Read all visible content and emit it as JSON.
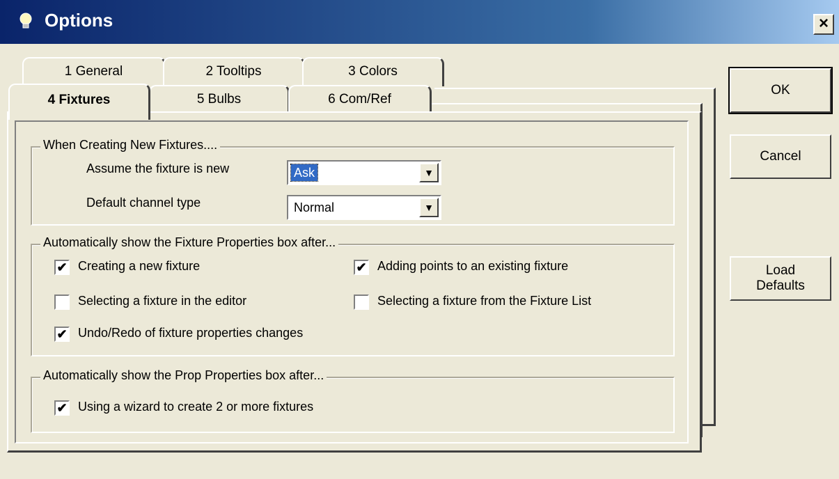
{
  "window": {
    "title": "Options",
    "close_label": "×"
  },
  "tabs": {
    "general": "1 General",
    "tooltips": "2 Tooltips",
    "colors": "3 Colors",
    "fixtures": "4 Fixtures",
    "bulbs": "5 Bulbs",
    "comref": "6 Com/Ref"
  },
  "groups": {
    "new_fixtures": {
      "legend": "When Creating New Fixtures....",
      "assume_label": "Assume the fixture is new",
      "assume_value": "Ask",
      "channel_label": "Default channel type",
      "channel_value": "Normal"
    },
    "fixture_props": {
      "legend": "Automatically show the Fixture Properties box after...",
      "items": [
        {
          "label": "Creating a new fixture",
          "checked": true
        },
        {
          "label": "Adding points to an existing fixture",
          "checked": true
        },
        {
          "label": "Selecting a fixture in the editor",
          "checked": false
        },
        {
          "label": "Selecting a fixture from the Fixture List",
          "checked": false
        },
        {
          "label": "Undo/Redo of fixture properties changes",
          "checked": true
        }
      ]
    },
    "prop_props": {
      "legend": "Automatically show the Prop Properties box after...",
      "items": [
        {
          "label": "Using a wizard to create 2 or more fixtures",
          "checked": true
        }
      ]
    }
  },
  "buttons": {
    "ok": "OK",
    "cancel": "Cancel",
    "load": "Load",
    "defaults": "Defaults"
  },
  "glyphs": {
    "check": "✔",
    "arrow": "▼"
  },
  "colors": {
    "title_start": "#0a246a",
    "title_end": "#a6caf0",
    "selection": "#316ac5",
    "face": "#ece9d8"
  }
}
